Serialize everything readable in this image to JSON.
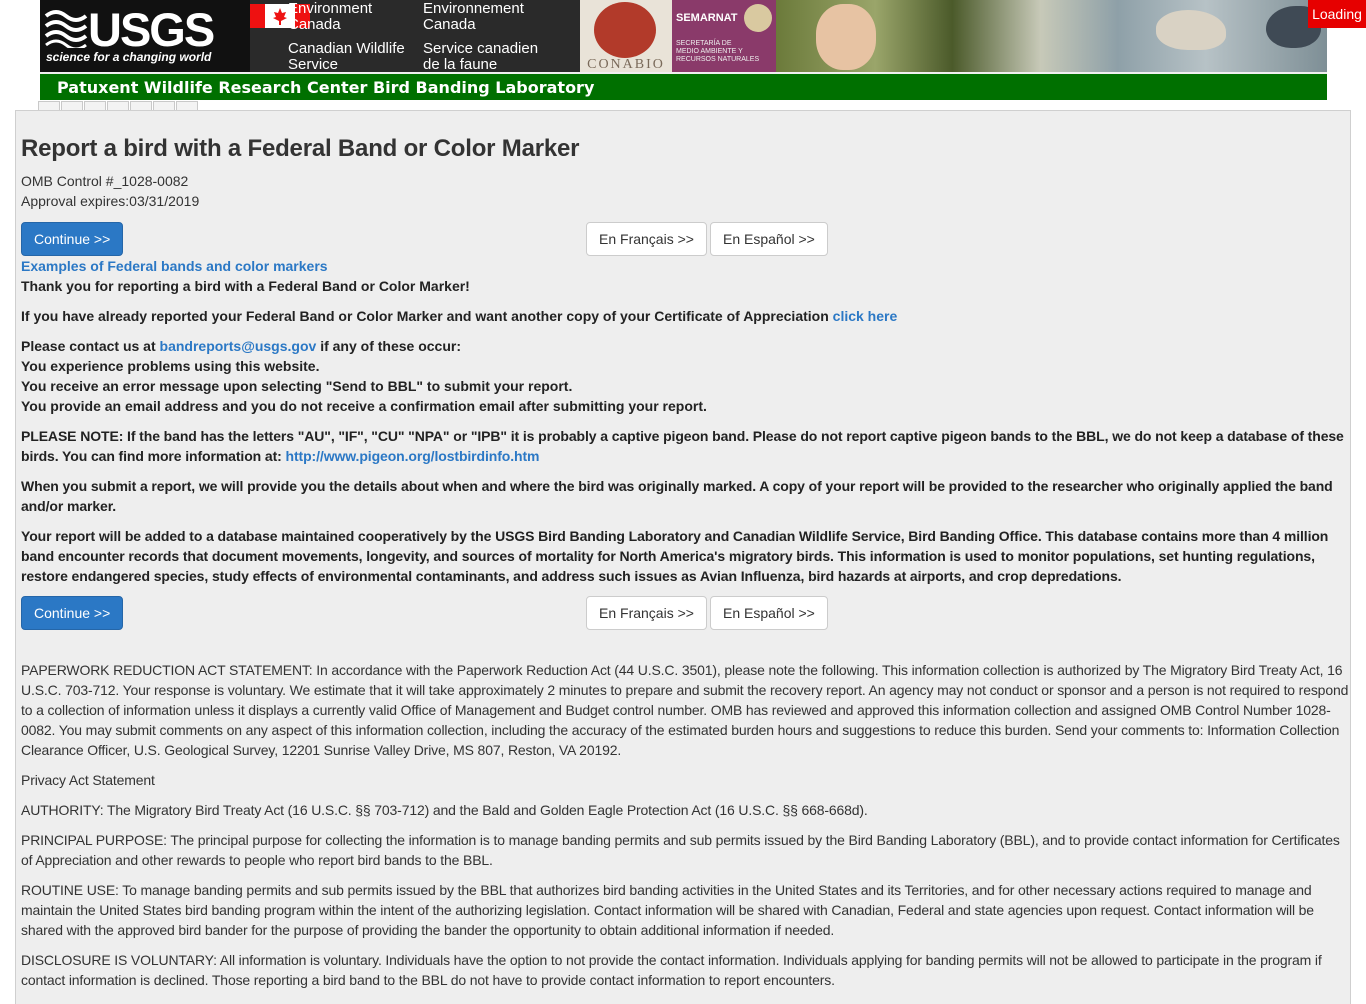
{
  "banner": {
    "usgs_logo": "USGS",
    "usgs_tagline": "science for a changing world",
    "env_canada_en": [
      "Environment",
      "Canada"
    ],
    "cws_en": [
      "Canadian Wildlife",
      "Service"
    ],
    "env_canada_fr": [
      "Environnement",
      "Canada"
    ],
    "cws_fr": [
      "Service canadien",
      "de la faune"
    ],
    "conabio": "CONABIO",
    "semarnat": "SEMARNAT",
    "semarnat_sub": [
      "SECRETARÍA DE",
      "MEDIO AMBIENTE Y",
      "RECURSOS NATURALES"
    ],
    "loading": "Loading",
    "subtitle": "Patuxent Wildlife Research Center Bird Banding Laboratory"
  },
  "page": {
    "title": "Report a bird with a Federal Band or Color Marker",
    "omb": "OMB Control #_1028-0082",
    "approval": "Approval expires:03/31/2019",
    "continue_label": "Continue >>",
    "french_label": "En Français >>",
    "spanish_label": "En Español >>",
    "examples_link": "Examples of Federal bands and color markers",
    "thanks": "Thank you for reporting a bird with a Federal Band or Color Marker!",
    "already_reported": "If you have already reported your Federal Band or Color Marker and want another copy of your Certificate of Appreciation",
    "click_here": "click here",
    "contact_prefix": "Please contact us at",
    "contact_email": "bandreports@usgs.gov",
    "contact_suffix": "if any of these occur:",
    "problems": [
      "You experience problems using this website.",
      "You receive an error message upon selecting \"Send to BBL\" to submit your report.",
      "You provide an email address and you do not receive a confirmation email after submitting your report."
    ],
    "note_text": "PLEASE NOTE: If the band has the letters \"AU\", \"IF\", \"CU\" \"NPA\" or \"IPB\" it is probably a captive pigeon band. Please do not report captive pigeon bands to the BBL, we do not keep a database of these birds. You can find more information at:",
    "note_link": "http://www.pigeon.org/lostbirdinfo.htm",
    "submit_info": "When you submit a report, we will provide you the details about when and where the bird was originally marked. A copy of your report will be provided to the researcher who originally applied the band and/or marker.",
    "database_info": "Your report will be added to a database maintained cooperatively by the USGS Bird Banding Laboratory and Canadian Wildlife Service, Bird Banding Office. This database contains more than 4 million band encounter records that document movements, longevity, and sources of mortality for North America's migratory birds. This information is used to monitor populations, set hunting regulations, restore endangered species, study effects of environmental contaminants, and address such issues as Avian Influenza, bird hazards at airports, and crop depredations.",
    "paperwork": "PAPERWORK REDUCTION ACT STATEMENT: In accordance with the Paperwork Reduction Act (44 U.S.C. 3501), please note the following. This information collection is authorized by The Migratory Bird Treaty Act, 16 U.S.C. 703-712. Your response is voluntary.  We estimate that it will take approximately 2 minutes to prepare and submit the recovery report. An agency may not conduct or sponsor and a person is not required to respond to a collection of information unless it displays a currently valid Office of Management and Budget control number. OMB has reviewed and approved this information collection and assigned OMB Control Number 1028-0082. You may submit comments on any aspect of this information collection, including the accuracy of the estimated burden hours and suggestions to reduce this burden. Send your comments to: Information Collection Clearance Officer, U.S. Geological Survey, 12201 Sunrise Valley Drive, MS 807, Reston, VA 20192.",
    "privacy_title": "Privacy Act Statement",
    "authority": "AUTHORITY: The Migratory Bird Treaty Act (16 U.S.C. §§ 703-712) and the Bald and Golden Eagle Protection Act (16 U.S.C. §§ 668-668d).",
    "purpose": "PRINCIPAL PURPOSE: The principal purpose for collecting the information is to manage banding permits and sub permits issued by the Bird Banding Laboratory (BBL), and to provide contact information for Certificates of Appreciation and other rewards to people who report bird bands to the BBL.",
    "routine": "ROUTINE USE:  To manage banding permits and sub permits issued by the BBL that authorizes bird banding activities in the United States and its Territories, and for other necessary actions required to manage and maintain the United States bird banding program within the intent of the authorizing legislation.  Contact information will be shared with Canadian, Federal and state agencies upon request.  Contact information will be shared with the approved bird bander for the purpose of providing the bander the opportunity to obtain additional information if needed.",
    "disclosure": "DISCLOSURE IS VOLUNTARY: All information is voluntary.  Individuals have the option to not provide the contact information. Individuals applying for banding permits will not be allowed to participate in the program if contact information is declined.  Those reporting a bird band to the BBL do not have to provide contact information to report encounters."
  },
  "colors": {
    "primary_button": "#2b78c5",
    "green_bar": "#007000",
    "loading_badge": "#e60000",
    "panel_bg": "#eeeeee",
    "link": "#2b78c5"
  }
}
